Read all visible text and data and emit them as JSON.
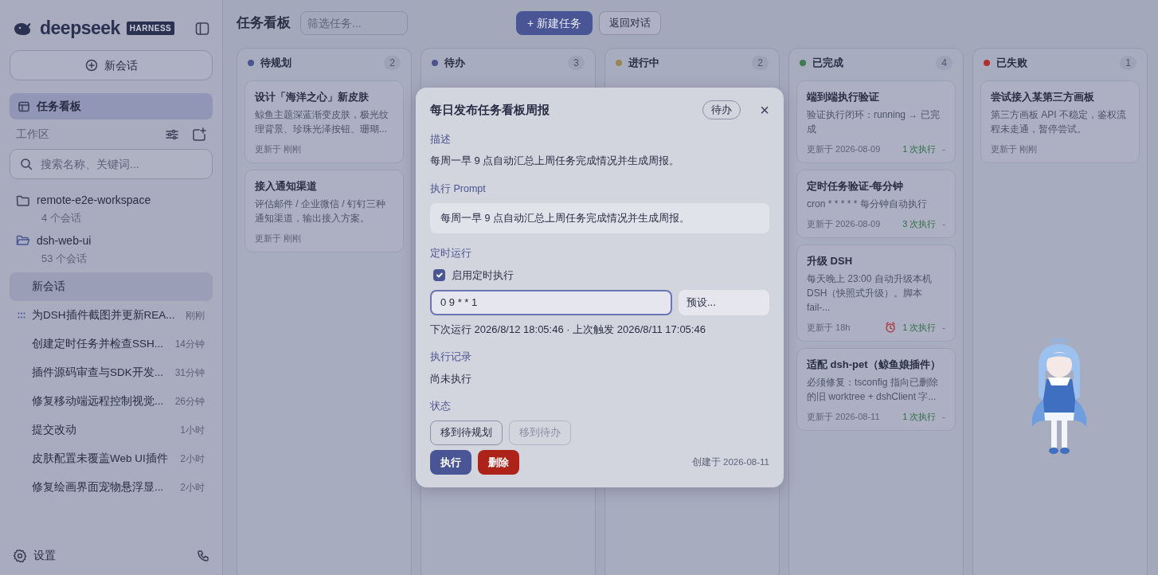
{
  "sidebar": {
    "logo": "deepseek",
    "badge": "HARNESS",
    "new_chat": "新会话",
    "nav": [
      {
        "label": "任务看板",
        "selected": true
      }
    ],
    "workspace_label": "工作区",
    "search": {
      "placeholder": "搜索名称、关键词..."
    },
    "workspaces": [
      {
        "name": "remote-e2e-workspace",
        "count": "4 个会话",
        "expanded": false
      },
      {
        "name": "dsh-web-ui",
        "count": "53 个会话",
        "expanded": true,
        "children": [
          {
            "title": "新会话",
            "selected": true,
            "running": false
          },
          {
            "title": "为DSH插件截图并更新REA...",
            "time": "刚刚",
            "selected": false,
            "running": true
          },
          {
            "title": "创建定时任务并检查SSH...",
            "time": "14分钟",
            "selected": false,
            "running": false
          },
          {
            "title": "插件源码审查与SDK开发...",
            "time": "31分钟",
            "selected": false,
            "running": false
          },
          {
            "title": "修复移动端远程控制视觉...",
            "time": "26分钟",
            "selected": false,
            "running": false
          },
          {
            "title": "提交改动",
            "time": "1小时",
            "selected": false,
            "running": false
          },
          {
            "title": "皮肤配置未覆盖Web UI插件",
            "time": "2小时",
            "selected": false,
            "running": false
          },
          {
            "title": "修复绘画界面宠物悬浮显...",
            "time": "2小时",
            "selected": false,
            "running": false
          }
        ]
      }
    ],
    "settings": "设置"
  },
  "header": {
    "title": "任务看板",
    "filter": {
      "placeholder": "筛选任务..."
    },
    "new_task": "+ 新建任务",
    "back": "返回对话"
  },
  "columns": [
    {
      "title": "待规划",
      "count": "2",
      "color": "#4a5590",
      "cards": [
        {
          "title": "设计「海洋之心」新皮肤",
          "description": "鲸鱼主题深蓝渐变皮肤，极光纹理背景、珍珠光泽按钮、珊瑚...",
          "updated": "更新于 刚刚"
        },
        {
          "title": "接入通知渠道",
          "description": "评估邮件 / 企业微信 / 钉钉三种通知渠道，输出接入方案。",
          "updated": "更新于 刚刚"
        }
      ]
    },
    {
      "title": "待办",
      "count": "3",
      "color": "#4a5590"
    },
    {
      "title": "进行中",
      "count": "2",
      "color": "#9a8456"
    },
    {
      "title": "已完成",
      "count": "4",
      "color": "#3f7a50",
      "cards": [
        {
          "title": "端到端执行验证",
          "description": "验证执行闭环：running → 已完成",
          "updated": "更新于 2026-08-09",
          "runs": "1 次执行",
          "tail": "-"
        },
        {
          "title": "定时任务验证-每分钟",
          "description": "cron * * * * * 每分钟自动执行",
          "updated": "更新于 2026-08-09",
          "runs": "3 次执行",
          "tail": "-"
        },
        {
          "title": "升级 DSH",
          "description": "每天晚上 23:00 自动升级本机 DSH（快照式升级）。脚本 fail-...",
          "updated": "更新于 18h",
          "alarm": true,
          "runs": "1 次执行",
          "tail": "-"
        },
        {
          "title": "适配 dsh-pet（鲸鱼娘插件）",
          "description": "必须修复：tsconfig 指向已删除的旧 worktree + dshClient 字...",
          "updated": "更新于 2026-08-11",
          "runs": "1 次执行",
          "tail": "-"
        }
      ]
    },
    {
      "title": "已失败",
      "count": "1",
      "color": "#b03030",
      "cards": [
        {
          "title": "尝试接入某第三方画板",
          "description": "第三方画板 API 不稳定，鉴权流程未走通，暂停尝试。",
          "updated": "更新于 刚刚"
        }
      ]
    }
  ],
  "dialog": {
    "title": "每日发布任务看板周报",
    "status": "待办",
    "close": "×",
    "description_label": "描述",
    "description": "每周一早 9 点自动汇总上周任务完成情况并生成周报。",
    "prompt_label": "执行 Prompt",
    "prompt": "每周一早 9 点自动汇总上周任务完成情况并生成周报。",
    "schedule_label": "定时运行",
    "schedule_enabled": {
      "label": "启用定时执行",
      "checked": true
    },
    "cron": "0 9 * * 1",
    "preset": "预设...",
    "next_run": "下次运行 2026/8/12 18:05:46 · 上次触发 2026/8/11 17:05:46",
    "history_label": "执行记录",
    "history": "尚未执行",
    "state_label": "状态",
    "state_buttons": [
      {
        "label": "移到待规划",
        "disabled": false
      },
      {
        "label": "移到待办",
        "disabled": true
      }
    ],
    "actions": [
      {
        "label": "执行",
        "kind": "primary"
      },
      {
        "label": "删除",
        "kind": "danger"
      }
    ],
    "created": "创建于 2026-08-11"
  }
}
